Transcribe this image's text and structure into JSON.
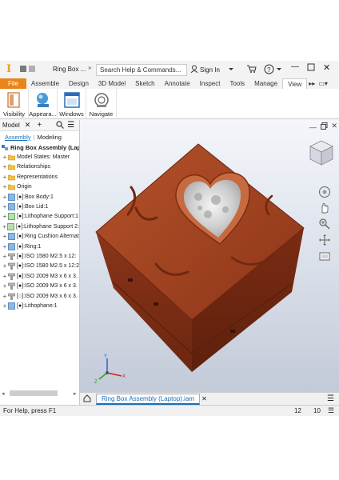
{
  "titlebar": {
    "doc_title": "Ring Box ...",
    "search_placeholder": "Search Help & Commands...",
    "sign_in": "Sign In"
  },
  "tabs": [
    "File",
    "Assemble",
    "Design",
    "3D Model",
    "Sketch",
    "Annotate",
    "Inspect",
    "Tools",
    "Manage",
    "View"
  ],
  "ribbon": {
    "buttons": [
      {
        "label": "Visibility"
      },
      {
        "label": "Appeara..."
      },
      {
        "label": "Windows"
      },
      {
        "label": "Navigate"
      }
    ]
  },
  "browser": {
    "title": "Model",
    "subtabs": {
      "assembly": "Assembly",
      "modeling": "Modeling"
    },
    "root": "Ring Box Assembly (Lapto",
    "items": [
      {
        "label": "Model States: Master",
        "icon": "folder-icon"
      },
      {
        "label": "Relationships",
        "icon": "folder-icon"
      },
      {
        "label": "Representations",
        "icon": "folder-icon"
      },
      {
        "label": "Origin",
        "icon": "folder-icon"
      },
      {
        "label": "[●]:Box Body:1",
        "icon": "part-icon"
      },
      {
        "label": "[●]:Box Lid:1",
        "icon": "part-icon"
      },
      {
        "label": "[●]:Lithophane Support:1",
        "icon": "part-green-icon"
      },
      {
        "label": "[●]:Lithophane Support 2:",
        "icon": "part-green-icon"
      },
      {
        "label": "[●]:Ring Cushion Alternat",
        "icon": "part-icon"
      },
      {
        "label": "[●]:Ring:1",
        "icon": "part-icon"
      },
      {
        "label": "[●]:ISO 1580 M2.5 x 12:",
        "icon": "fastener-icon"
      },
      {
        "label": "[●]:ISO 1580 M2.5 x 12:2",
        "icon": "fastener-icon"
      },
      {
        "label": "[●]:ISO 2009 M3 x 6 x 3.",
        "icon": "fastener-icon"
      },
      {
        "label": "[●]:ISO 2009 M3 x 6 x 3.",
        "icon": "fastener-icon"
      },
      {
        "label": "[○]:ISO 2009 M3 x 6 x 3.",
        "icon": "fastener-icon"
      },
      {
        "label": "[●]:Lithophane:1",
        "icon": "part-icon"
      }
    ]
  },
  "document_tab": "Ring Box Assembly (Laptop).iam",
  "status": {
    "message": "For Help, press F1",
    "count_a": "12",
    "count_b": "10"
  },
  "colors": {
    "file_tab": "#e8841a",
    "box_body": "#a3421f",
    "accent": "#1a6fb5"
  }
}
